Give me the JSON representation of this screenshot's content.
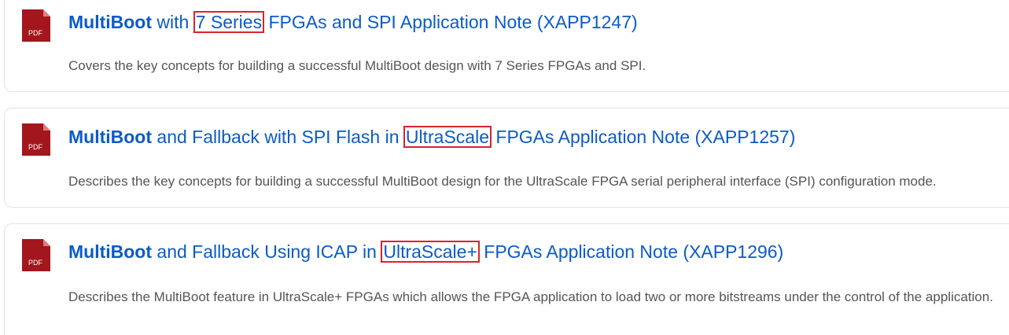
{
  "results": [
    {
      "icon": "pdf-icon",
      "icon_label": "PDF",
      "title_bold": "MultiBoot",
      "title_pre": " with ",
      "title_highlight": "7 Series",
      "title_post": " FPGAs and SPI Application Note (XAPP1247)",
      "description": "Covers the key concepts for building a successful MultiBoot design with 7 Series FPGAs and SPI."
    },
    {
      "icon": "pdf-icon",
      "icon_label": "PDF",
      "title_bold": "MultiBoot",
      "title_pre": " and Fallback with SPI Flash in ",
      "title_highlight": "UltraScale",
      "title_post": " FPGAs Application Note (XAPP1257)",
      "description": "Describes the key concepts for building a successful MultiBoot design for the UltraScale FPGA serial peripheral interface (SPI) configuration mode."
    },
    {
      "icon": "pdf-icon",
      "icon_label": "PDF",
      "title_bold": "MultiBoot",
      "title_pre": " and Fallback Using ICAP in ",
      "title_highlight": "UltraScale+",
      "title_post": " FPGAs Application Note (XAPP1296)",
      "description": "Describes the MultiBoot feature in UltraScale+ FPGAs which allows the FPGA application to load two or more bitstreams under the control of the application."
    }
  ],
  "colors": {
    "link": "#0b5bc7",
    "highlight_box": "#d9232e",
    "pdf_icon": "#a3161d",
    "description": "#555555"
  }
}
